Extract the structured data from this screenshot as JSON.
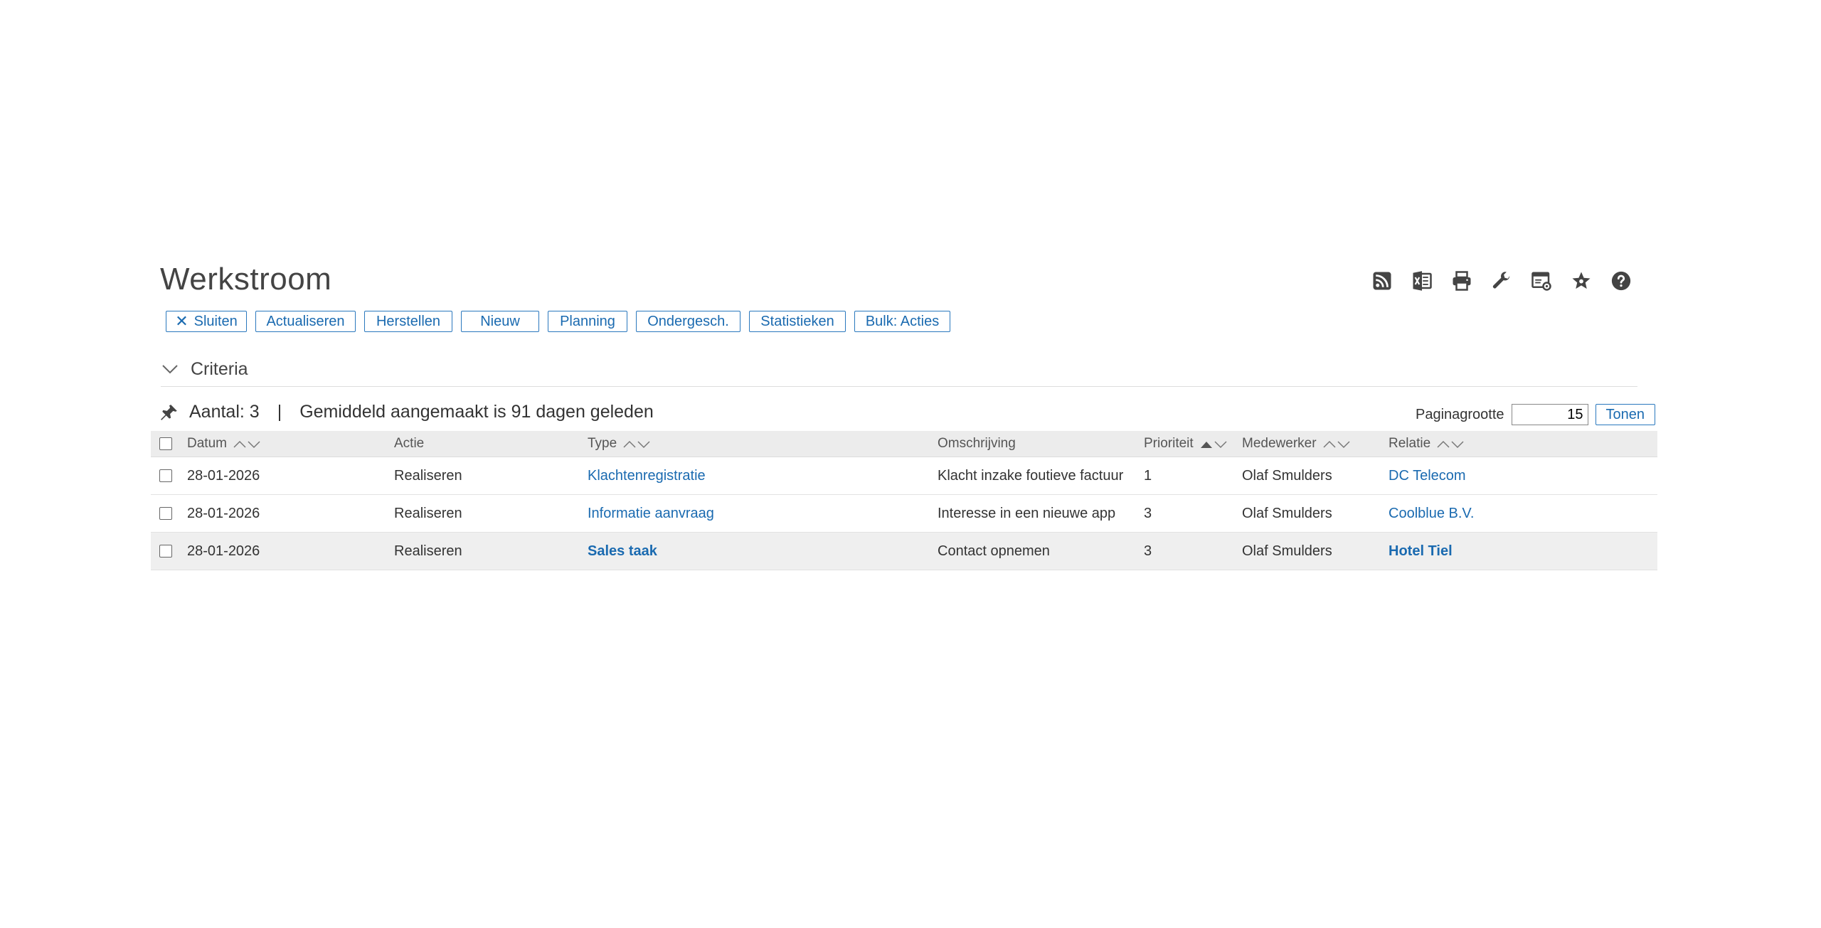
{
  "page": {
    "title": "Werkstroom"
  },
  "header_icons": [
    "rss-icon",
    "excel-icon",
    "print-icon",
    "wrench-icon",
    "window-settings-icon",
    "star-icon",
    "help-icon"
  ],
  "toolbar": {
    "buttons": [
      "Sluiten",
      "Actualiseren",
      "Herstellen",
      "Nieuw",
      "Planning",
      "Ondergesch.",
      "Statistieken",
      "Bulk: Acties"
    ]
  },
  "criteria": {
    "label": "Criteria"
  },
  "summary": {
    "count_text": "Aantal: 3",
    "separator": "|",
    "average_text": "Gemiddeld aangemaakt is 91 dagen geleden"
  },
  "pagesize": {
    "label": "Paginagrootte",
    "value": "15",
    "button": "Tonen"
  },
  "table": {
    "columns": [
      "Datum",
      "Actie",
      "Type",
      "Omschrijving",
      "Prioriteit",
      "Medewerker",
      "Relatie"
    ],
    "rows": [
      {
        "datum": "28-01-2026",
        "actie": "Realiseren",
        "type": "Klachtenregistratie",
        "omschrijving": "Klacht inzake foutieve factuur",
        "prioriteit": "1",
        "medewerker": "Olaf Smulders",
        "relatie": "DC Telecom"
      },
      {
        "datum": "28-01-2026",
        "actie": "Realiseren",
        "type": "Informatie aanvraag",
        "omschrijving": "Interesse in een nieuwe app",
        "prioriteit": "3",
        "medewerker": "Olaf Smulders",
        "relatie": "Coolblue B.V."
      },
      {
        "datum": "28-01-2026",
        "actie": "Realiseren",
        "type": "Sales taak",
        "omschrijving": "Contact opnemen",
        "prioriteit": "3",
        "medewerker": "Olaf Smulders",
        "relatie": "Hotel Tiel"
      }
    ]
  },
  "colors": {
    "link": "#1a6ab0",
    "header_bg": "#ececec",
    "selected_row_bg": "#efefef"
  }
}
